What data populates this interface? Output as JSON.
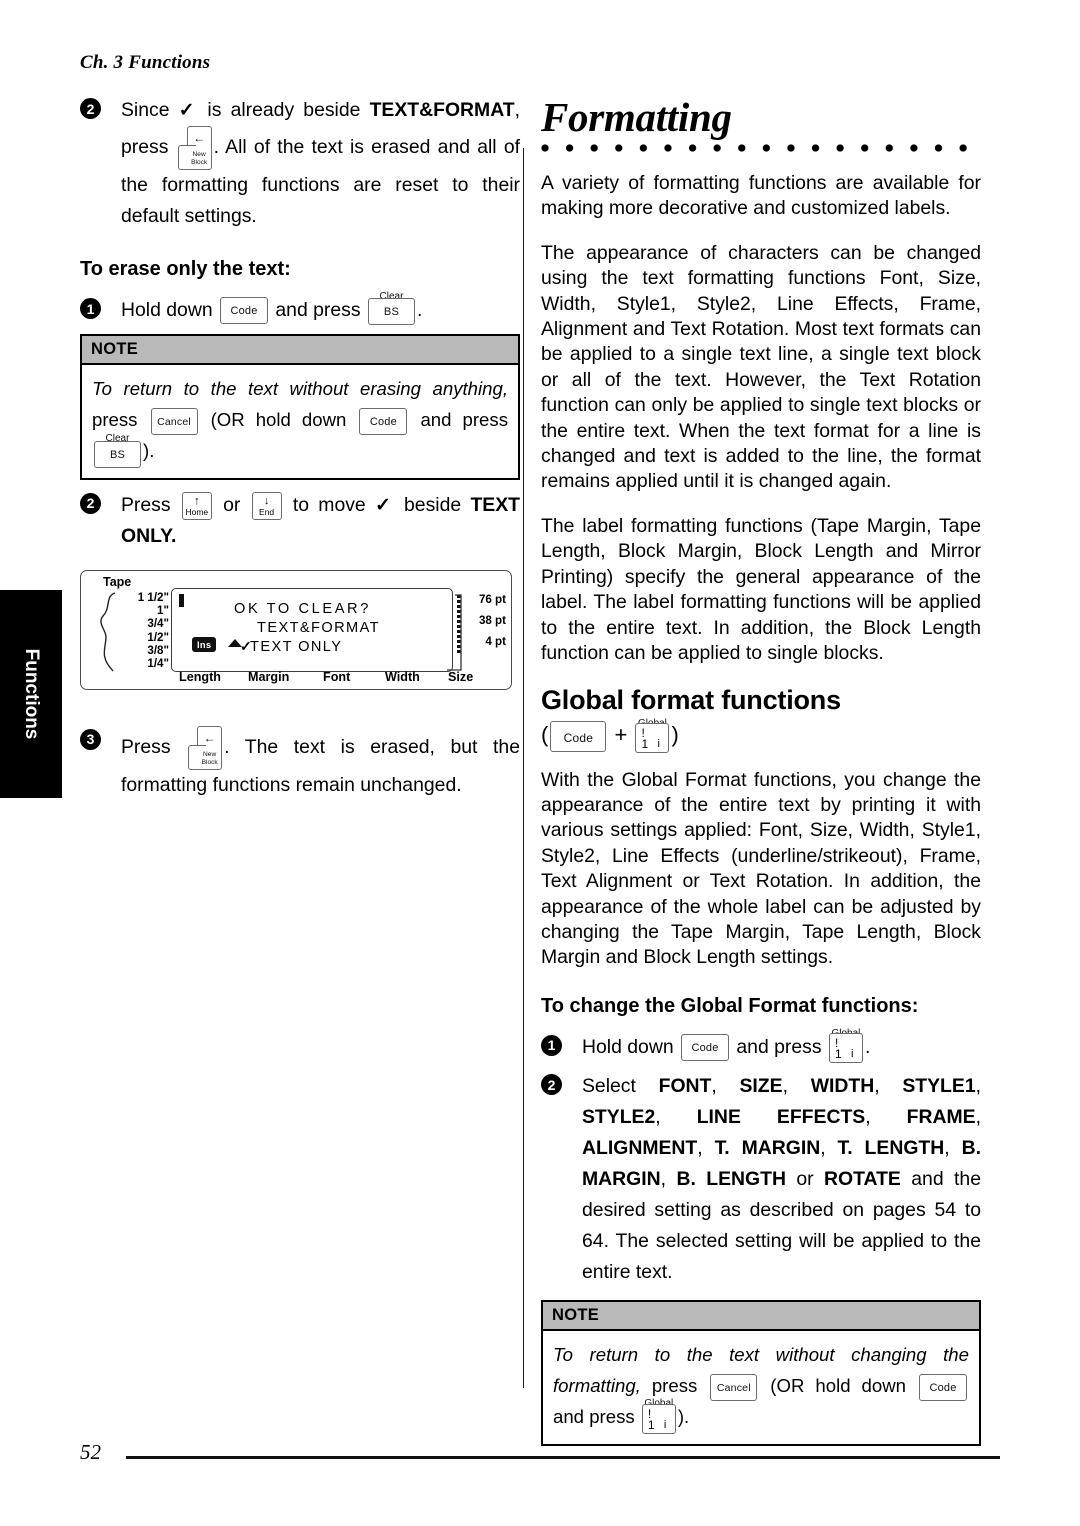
{
  "page": {
    "running_head": "Ch. 3 Functions",
    "page_number": "52",
    "side_tab_label": "Functions"
  },
  "left_column": {
    "step_2_intro": {
      "number": "2",
      "text_a": "Since ",
      "check": "✓",
      "text_b": " is already beside ",
      "bold": "TEXT&FORMAT",
      "text_c": ", press ",
      "text_d": ". All of the text is erased and all of the formatting functions are reset to their default settings."
    },
    "subheading": "To erase only the text:",
    "step_1": {
      "number": "1",
      "text_a": "Hold down ",
      "text_b": " and press ",
      "text_c": "."
    },
    "note": {
      "header": "NOTE",
      "italic_a": "To return to the text without erasing anything,",
      "text_b": " press ",
      "text_c": " (OR hold down ",
      "text_d": " and press ",
      "text_e": ")."
    },
    "step_2": {
      "number": "2",
      "text_a": "Press ",
      "text_b": " or ",
      "text_c": " to move ",
      "check": "✓",
      "text_d": " beside ",
      "bold": "TEXT ONLY",
      "text_e": "."
    },
    "step_3": {
      "number": "3",
      "text_a": "Press ",
      "text_b": ". The text is erased, but the formatting functions remain unchanged."
    }
  },
  "lcd": {
    "tape_label": "Tape",
    "tape_values": [
      "1 1/2\"",
      "1\"",
      "3/4\"",
      "1/2\"",
      "3/8\"",
      "1/4\""
    ],
    "line1": "OK TO CLEAR?",
    "line2": "TEXT&FORMAT",
    "line3": "TEXT ONLY",
    "line3_check": "✓",
    "ins_badge": "Ins",
    "pt_values": [
      "76 pt",
      "38 pt",
      "4 pt"
    ],
    "bottom_labels": [
      "Length",
      "Margin",
      "Font",
      "Width",
      "Size"
    ]
  },
  "right_column": {
    "title": "Formatting",
    "para_1": "A variety of formatting functions are available for making more decorative and customized labels.",
    "para_2": "The appearance of characters can be changed using the text formatting functions Font, Size, Width, Style1, Style2, Line Effects, Frame, Alignment and Text Rotation. Most text formats can be applied to a single text line, a single text block or all of the text. However, the Text Rotation function can only be applied to single text blocks or the entire text. When the text format for a line is changed and text is added to the line, the format remains applied until it is changed again.",
    "para_3": "The label formatting functions (Tape Margin, Tape Length, Block Margin, Block Length and Mirror Printing) specify the general appearance of the label. The label formatting functions will be applied to the entire text. In addition, the Block Length function can be applied to single blocks.",
    "section_heading": "Global format functions",
    "combo_open": "(",
    "combo_plus": "+",
    "combo_close": ")",
    "para_4": "With the Global Format functions, you change the appearance of the entire text by printing it with various settings applied: Font, Size, Width, Style1, Style2, Line Effects (underline/strikeout), Frame, Text Alignment or Text Rotation. In addition, the appearance of the whole label can be adjusted by changing the Tape Margin, Tape Length, Block Margin and Block Length settings.",
    "subheading": "To change the Global Format functions:",
    "step_1": {
      "number": "1",
      "text_a": "Hold down ",
      "text_b": " and press ",
      "text_c": "."
    },
    "step_2": {
      "number": "2",
      "text_a": "Select ",
      "b1": "FONT",
      "b2": "SIZE",
      "b3": "WIDTH",
      "b4": "STYLE1",
      "b5": "STYLE2",
      "b6": "LINE EFFECTS",
      "b7": "FRAME",
      "b8": "ALIGNMENT",
      "b9": "T. MARGIN",
      "b10": "T. LENGTH",
      "b11": "B. MARGIN",
      "b12": "B. LENGTH",
      "or": " or ",
      "b13": "ROTATE",
      "tail": " and the desired setting as described on pages 54 to 64. The selected setting will be applied to the entire text.",
      "sep": ", "
    },
    "note": {
      "header": "NOTE",
      "italic_a": "To return to the text without changing the formatting,",
      "text_b": " press ",
      "text_c": " (OR hold down ",
      "text_d": " and press ",
      "text_e": ")."
    }
  },
  "keys": {
    "code": "Code",
    "bs": "BS",
    "bs_over": "Clear",
    "cancel": "Cancel",
    "home_arrow": "↑",
    "home": "Home",
    "end_arrow": "↓",
    "end": "End",
    "global_over": "Global",
    "global_excl": "!",
    "global_one": "1",
    "global_i": "i",
    "newblock_arrow": "←",
    "newblock_l1": "New",
    "newblock_l2": "Block"
  },
  "colors": {
    "note_header_bg": "#b9b9b9",
    "ink": "#000000",
    "key_border": "#6b6b6b"
  }
}
